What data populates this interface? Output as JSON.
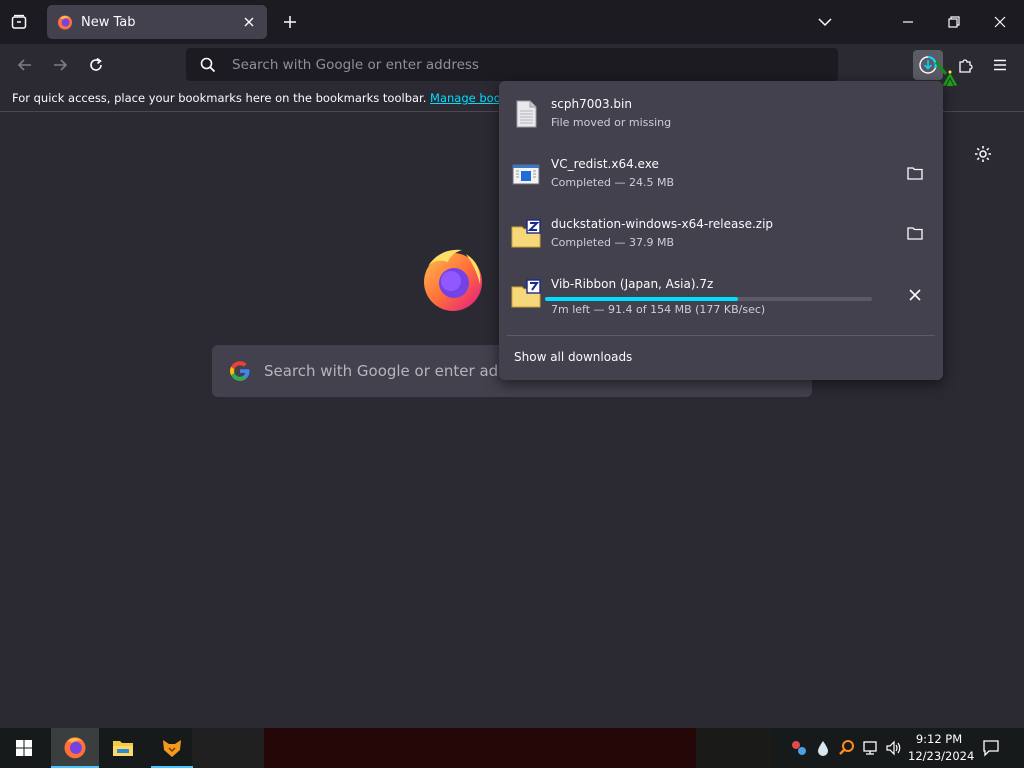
{
  "browser": {
    "tab": {
      "title": "New Tab"
    },
    "urlbar": {
      "placeholder": "Search with Google or enter address"
    },
    "bookmarks_bar": {
      "message": "For quick access, place your bookmarks here on the bookmarks toolbar. ",
      "link": "Manage bookmarks"
    }
  },
  "newtab": {
    "search_placeholder": "Search with Google or enter address"
  },
  "downloads": {
    "items": [
      {
        "name": "scph7003.bin",
        "status": "File moved or missing",
        "icon": "file-icon",
        "action": ""
      },
      {
        "name": "VC_redist.x64.exe",
        "status": "Completed — 24.5 MB",
        "icon": "installer-icon",
        "action": "show-in-folder"
      },
      {
        "name": "duckstation-windows-x64-release.zip",
        "status": "Completed — 37.9 MB",
        "icon": "zip-archive-icon",
        "action": "show-in-folder"
      },
      {
        "name": "Vib-Ribbon (Japan, Asia).7z",
        "status": "7m left — 91.4 of 154 MB (177 KB/sec)",
        "icon": "7z-archive-icon",
        "action": "cancel",
        "progress": 0.59
      }
    ],
    "show_all": "Show all downloads"
  },
  "taskbar": {
    "clock_time": "9:12 PM",
    "clock_date": "12/23/2024"
  },
  "colors": {
    "accent": "#00ddff",
    "toolbar": "#2b2a33",
    "tabstrip": "#1c1b22",
    "panel": "#42414d"
  }
}
